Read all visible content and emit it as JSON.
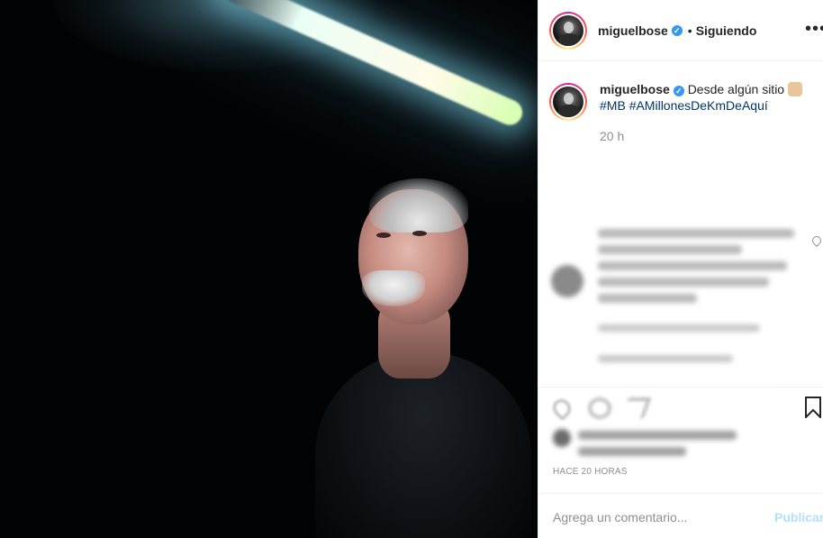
{
  "post": {
    "username": "miguelbose",
    "verified_badge": "verified-icon",
    "follow_state": "Siguiendo",
    "more_icon": "more-options-icon"
  },
  "caption": {
    "username": "miguelbose",
    "text": "Desde algún sitio",
    "emoji": "raised-hand-emoji",
    "hashtags": [
      "#MB",
      "#AMillonesDeKmDeAquí"
    ],
    "time_ago": "20 h"
  },
  "timestamp": "HACE 20 HORAS",
  "comment_input": {
    "placeholder": "Agrega un comentario...",
    "submit_label": "Publicar"
  },
  "colors": {
    "link_blue": "#003569",
    "verified_blue": "#3897f0",
    "publish_disabled": "#b2dffc",
    "muted_text": "#8e8e8e"
  }
}
